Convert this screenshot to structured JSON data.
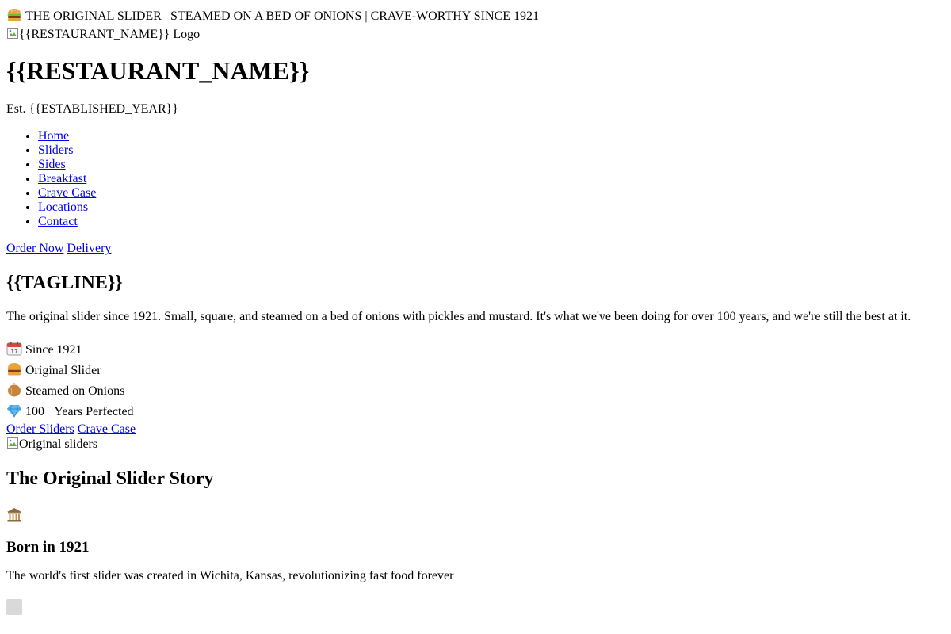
{
  "announcement": {
    "icon": "burger-icon",
    "text": "THE ORIGINAL SLIDER | STEAMED ON A BED OF ONIONS | CRAVE-WORTHY SINCE 1921"
  },
  "logo": {
    "alt": "{{RESTAURANT_NAME}} Logo"
  },
  "header": {
    "title": "{{RESTAURANT_NAME}}",
    "established": "Est. {{ESTABLISHED_YEAR}}"
  },
  "nav": {
    "items": [
      "Home",
      "Sliders",
      "Sides",
      "Breakfast",
      "Crave Case",
      "Locations",
      "Contact"
    ]
  },
  "header_ctas": {
    "order": "Order Now",
    "delivery": "Delivery"
  },
  "hero": {
    "tagline": "{{TAGLINE}}",
    "description": "The original slider since 1921. Small, square, and steamed on a bed of onions with pickles and mustard. It's what we've been doing for over 100 years, and we're still the best at it.",
    "features": [
      {
        "icon": "calendar-icon",
        "text": "Since 1921"
      },
      {
        "icon": "burger-icon",
        "text": "Original Slider"
      },
      {
        "icon": "onion-icon",
        "text": "Steamed on Onions"
      },
      {
        "icon": "diamond-icon",
        "text": "100+ Years Perfected"
      }
    ],
    "cta_order": "Order Sliders",
    "cta_crave": "Crave Case",
    "image_alt": "Original sliders"
  },
  "story": {
    "title": "The Original Slider Story",
    "icon": "museum-icon",
    "card_title": "Born in 1921",
    "card_text": "The world's first slider was created in Wichita, Kansas, revolutionizing fast food forever"
  }
}
